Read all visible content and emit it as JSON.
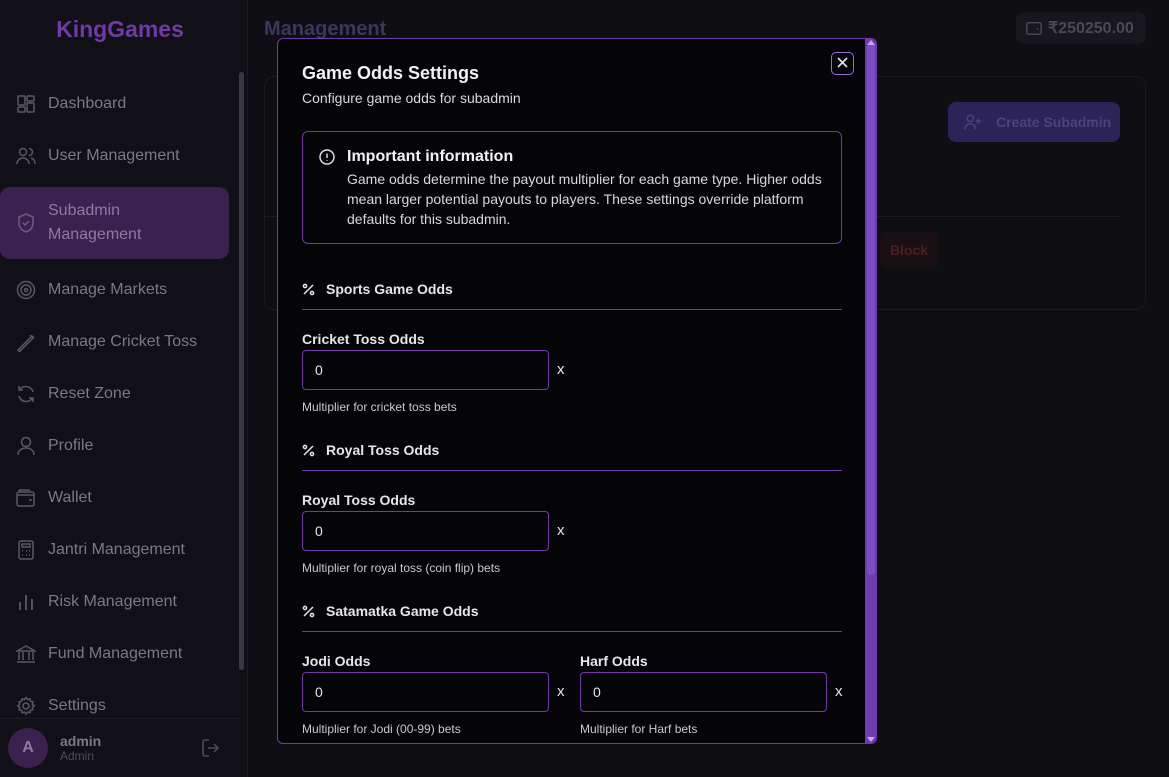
{
  "brand": "KingGames",
  "sidebar": {
    "items": [
      {
        "label": "Dashboard",
        "icon": "dashboard-icon"
      },
      {
        "label": "User Management",
        "icon": "users-icon"
      },
      {
        "label": "Subadmin Management",
        "icon": "shield-icon",
        "active": true
      },
      {
        "label": "Manage Markets",
        "icon": "target-icon"
      },
      {
        "label": "Manage Cricket Toss",
        "icon": "pencil-icon"
      },
      {
        "label": "Reset Zone",
        "icon": "refresh-icon"
      },
      {
        "label": "Profile",
        "icon": "user-icon"
      },
      {
        "label": "Wallet",
        "icon": "wallet-icon"
      },
      {
        "label": "Jantri Management",
        "icon": "calculator-icon"
      },
      {
        "label": "Risk Management",
        "icon": "bar-chart-icon"
      },
      {
        "label": "Fund Management",
        "icon": "bank-icon"
      },
      {
        "label": "Settings",
        "icon": "gear-icon"
      }
    ],
    "user": {
      "initial": "A",
      "name": "admin",
      "role": "Admin"
    }
  },
  "header": {
    "title": "Management",
    "balance": "₹250250.00"
  },
  "main": {
    "create_button": "Create Subadmin",
    "block_button": "Block"
  },
  "modal": {
    "title": "Game Odds Settings",
    "subtitle": "Configure game odds for subadmin",
    "info": {
      "title": "Important information",
      "text": "Game odds determine the payout multiplier for each game type. Higher odds mean larger potential payouts to players. These settings override platform defaults for this subadmin."
    },
    "sections": {
      "sports": {
        "title": "Sports Game Odds"
      },
      "royal": {
        "title": "Royal Toss Odds"
      },
      "satamatka": {
        "title": "Satamatka Game Odds"
      }
    },
    "fields": {
      "cricket_toss": {
        "label": "Cricket Toss Odds",
        "value": "0",
        "suffix": "x",
        "help": "Multiplier for cricket toss bets"
      },
      "royal_toss": {
        "label": "Royal Toss Odds",
        "value": "0",
        "suffix": "x",
        "help": "Multiplier for royal toss (coin flip) bets"
      },
      "jodi": {
        "label": "Jodi Odds",
        "value": "0",
        "suffix": "x",
        "help": "Multiplier for Jodi (00-99) bets"
      },
      "harf": {
        "label": "Harf Odds",
        "value": "0",
        "suffix": "x",
        "help": "Multiplier for Harf bets"
      }
    }
  },
  "colors": {
    "accent": "#6d3aa6",
    "scrollbar": "#7c4bc8",
    "background": "#050507"
  }
}
